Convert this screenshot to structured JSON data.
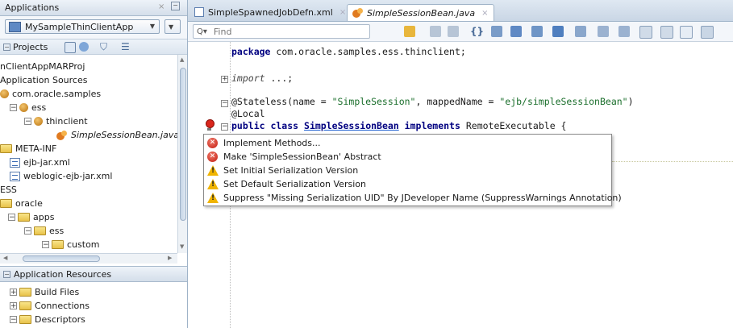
{
  "left_panel": {
    "title": "Applications",
    "app_selector": "MySampleThinClientApp",
    "projects_label": "Projects",
    "tree": [
      {
        "label": "nClientAppMARProj",
        "level": 0,
        "icon": "none"
      },
      {
        "label": "Application Sources",
        "level": 0,
        "icon": "none"
      },
      {
        "label": "com.oracle.samples",
        "level": 0,
        "icon": "package"
      },
      {
        "label": "ess",
        "level": 1,
        "icon": "package"
      },
      {
        "label": "thinclient",
        "level": 2,
        "icon": "package"
      },
      {
        "label": "SimpleSessionBean.java",
        "level": 3,
        "icon": "bean"
      },
      {
        "label": "META-INF",
        "level": 0,
        "icon": "folder"
      },
      {
        "label": "ejb-jar.xml",
        "level": 1,
        "icon": "xml"
      },
      {
        "label": "weblogic-ejb-jar.xml",
        "level": 1,
        "icon": "xml"
      },
      {
        "label": "ESS",
        "level": 0,
        "icon": "none"
      },
      {
        "label": "oracle",
        "level": 0,
        "icon": "folder"
      },
      {
        "label": "apps",
        "level": 1,
        "icon": "folder"
      },
      {
        "label": "ess",
        "level": 2,
        "icon": "folder"
      },
      {
        "label": "custom",
        "level": 3,
        "icon": "folder"
      }
    ],
    "resources_title": "Application Resources",
    "resources": [
      "Build Files",
      "Connections",
      "Descriptors"
    ]
  },
  "editor": {
    "tabs": [
      {
        "label": "SimpleSpawnedJobDefn.xml",
        "active": false
      },
      {
        "label": "SimpleSessionBean.java",
        "active": true
      }
    ],
    "find_placeholder": "Find",
    "code": {
      "package_kw": "package",
      "package_name": " com.oracle.samples.ess.thinclient;",
      "import_kw": "import",
      "import_rest": " ...;",
      "stateless_pre": "@Stateless(name = ",
      "stateless_name": "\"SimpleSession\"",
      "stateless_mid": ", mappedName = ",
      "stateless_mapped": "\"ejb/simpleSessionBean\"",
      "stateless_end": ")",
      "local": "@Local",
      "public_class_kw": "public class",
      "class_name": "SimpleSessionBean",
      "implements_kw": "implements",
      "interface": " RemoteExecutable {"
    }
  },
  "popup": {
    "items": [
      {
        "label": "Implement Methods...",
        "type": "error"
      },
      {
        "label": "Make 'SimpleSessionBean' Abstract",
        "type": "error"
      },
      {
        "label": "Set Initial Serialization Version",
        "type": "warning"
      },
      {
        "label": "Set Default Serialization Version",
        "type": "warning"
      },
      {
        "label": "Suppress \"Missing Serialization UID\" By JDeveloper Name (SuppressWarnings Annotation)",
        "type": "warning"
      }
    ]
  }
}
